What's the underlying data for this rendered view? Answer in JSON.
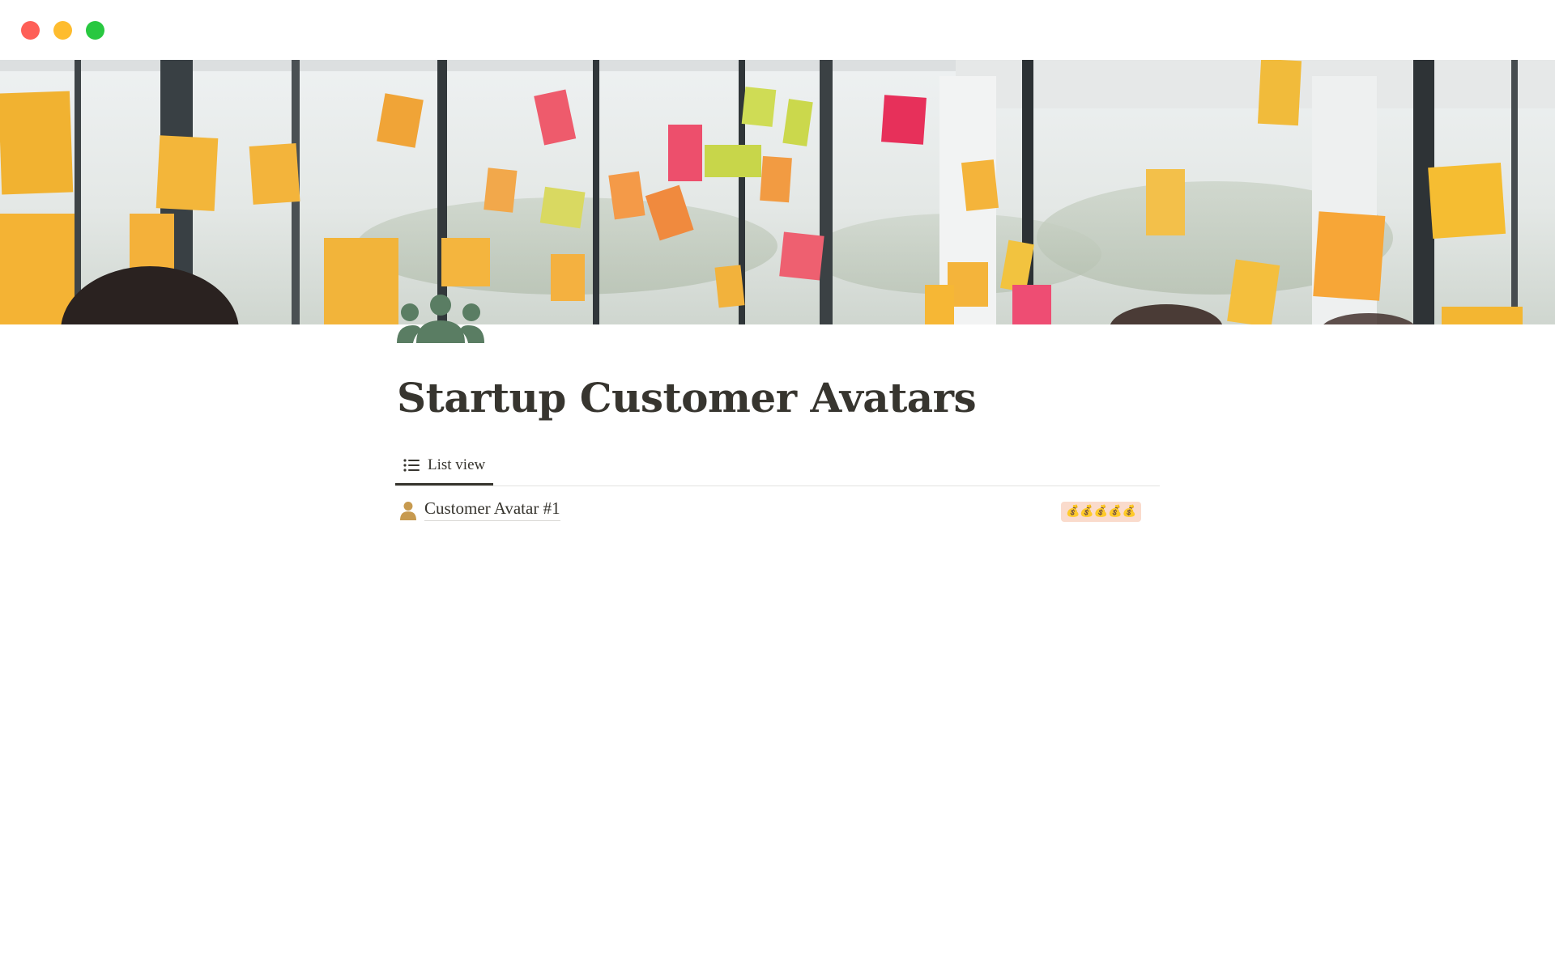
{
  "window": {
    "buttons": [
      "close",
      "minimize",
      "maximize"
    ],
    "colors": {
      "close": "#fe5f57",
      "minimize": "#febc2e",
      "maximize": "#28c840"
    }
  },
  "cover": {
    "icon": "sticky-notes-office-cover-image"
  },
  "page": {
    "icon": "people-group-icon",
    "icon_color": "#5a7d63",
    "title": "Startup Customer Avatars"
  },
  "tabs": [
    {
      "label": "List view",
      "icon": "list-icon",
      "active": true
    }
  ],
  "list": {
    "rows": [
      {
        "icon": "person-icon",
        "icon_color": "#c79a4f",
        "title": "Customer Avatar #1",
        "tag": "💰💰💰💰💰",
        "tag_color": "#fadbcc"
      }
    ]
  }
}
